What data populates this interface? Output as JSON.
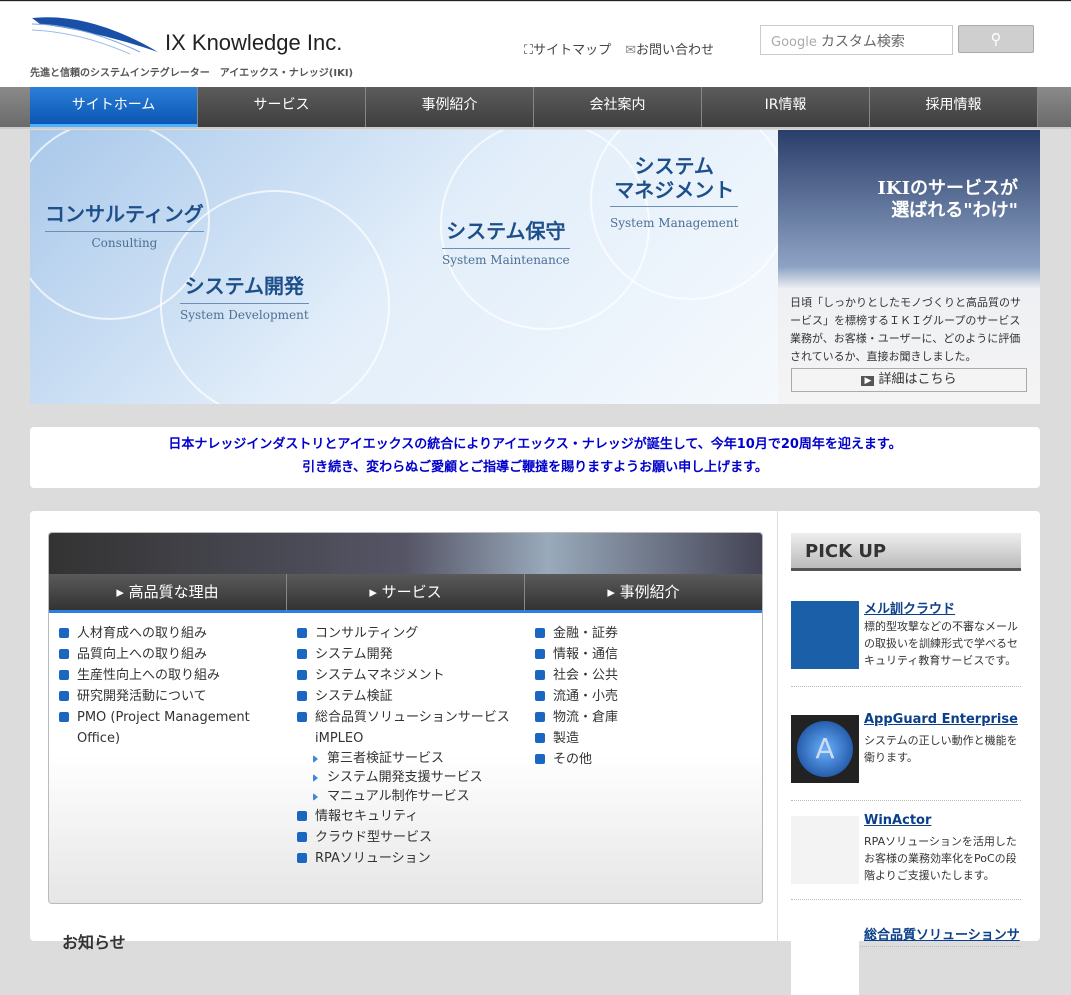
{
  "header": {
    "logo_name": "IX Knowledge Inc.",
    "tagline": "先進と信頼のシステムインテグレーター　アイエックス・ナレッジ(IKI)",
    "sitemap": "サイトマップ",
    "contact": "お問い合わせ",
    "search_brand": "Google",
    "search_placeholder": "カスタム検索"
  },
  "nav": [
    "サイトホーム",
    "サービス",
    "事例紹介",
    "会社案内",
    "IR情報",
    "採用情報"
  ],
  "banner": {
    "items": [
      {
        "jp": "コンサルティング",
        "en": "Consulting"
      },
      {
        "jp": "システム開発",
        "en": "System Development"
      },
      {
        "jp": "システム保守",
        "en": "System Maintenance"
      },
      {
        "jp": "システム\nマネジメント",
        "en": "System Management"
      }
    ]
  },
  "promo": {
    "title1": "IKIのサービスが",
    "title2": "選ばれる\"わけ\"",
    "text": "日頃「しっかりとしたモノづくりと高品質のサービス」を標榜するＩＫＩグループのサービス業務が、お客様・ユーザーに、どのように評価されているか、直接お聞きしました。",
    "button": "詳細はこちら"
  },
  "notice": {
    "line1": "日本ナレッジインダストリとアイエックスの統合によりアイエックス・ナレッジが誕生して、今年10月で20周年を迎えます。",
    "line2": "引き続き、変わらぬご愛顧とご指導ご鞭撻を賜りますようお願い申し上げます。"
  },
  "columns": [
    {
      "title": "高品質な理由",
      "items": [
        {
          "t": "人材育成への取り組み"
        },
        {
          "t": "品質向上への取り組み"
        },
        {
          "t": "生産性向上への取り組み"
        },
        {
          "t": "研究開発活動について"
        },
        {
          "t": "PMO (Project Management Office)"
        }
      ]
    },
    {
      "title": "サービス",
      "items": [
        {
          "t": "コンサルティング"
        },
        {
          "t": "システム開発"
        },
        {
          "t": "システムマネジメント"
        },
        {
          "t": "システム検証"
        },
        {
          "t": "総合品質ソリューションサービスiMPLEO"
        },
        {
          "t": "第三者検証サービス",
          "sub": true
        },
        {
          "t": "システム開発支援サービス",
          "sub": true
        },
        {
          "t": "マニュアル制作サービス",
          "sub": true
        },
        {
          "t": "情報セキュリティ"
        },
        {
          "t": "クラウド型サービス"
        },
        {
          "t": "RPAソリューション"
        }
      ]
    },
    {
      "title": "事例紹介",
      "items": [
        {
          "t": "金融・証券"
        },
        {
          "t": "情報・通信"
        },
        {
          "t": "社会・公共"
        },
        {
          "t": "流通・小売"
        },
        {
          "t": "物流・倉庫"
        },
        {
          "t": "製造"
        },
        {
          "t": "その他"
        }
      ]
    }
  ],
  "pickup": {
    "title": "PICK UP",
    "items": [
      {
        "name": "メル訓クラウド",
        "desc": "標的型攻撃などの不審なメールの取扱いを訓練形式で学べるセキュリティ教育サービスです。"
      },
      {
        "name": "AppGuard Enterprise",
        "desc": "システムの正しい動作と機能を衛ります。"
      },
      {
        "name": "WinActor",
        "desc": "RPAソリューションを活用したお客様の業務効率化をPoCの段階よりご支援いたします。"
      },
      {
        "name": "総合品質ソリューションサ",
        "desc": ""
      }
    ]
  },
  "news_title": "お知らせ"
}
